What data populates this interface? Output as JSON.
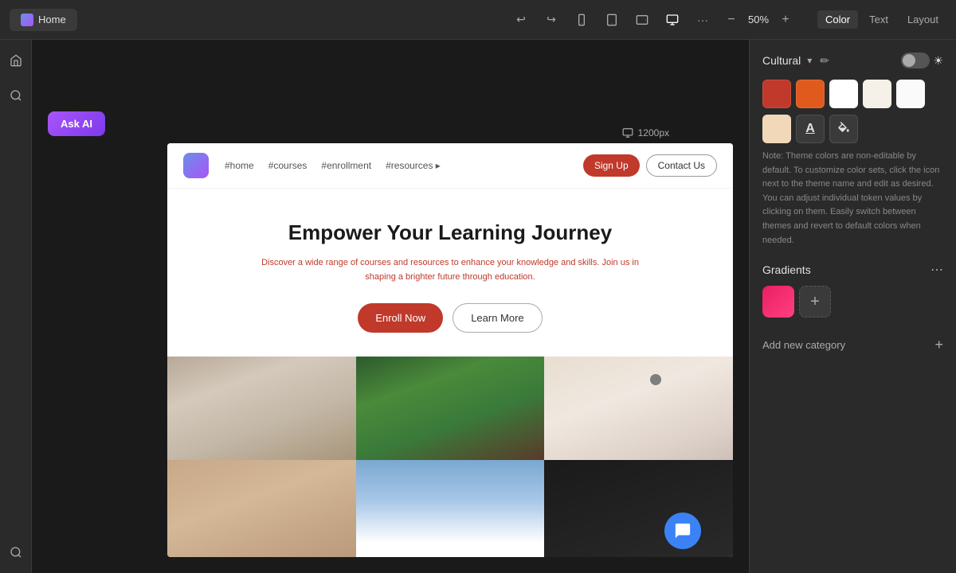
{
  "topbar": {
    "tab_label": "Home",
    "zoom": "50%",
    "zoom_minus": "−",
    "zoom_plus": "+"
  },
  "right_panel": {
    "tabs": [
      "Color",
      "Text",
      "Layout"
    ],
    "active_tab": "Color",
    "theme_name": "Cultural",
    "toggle_state": false,
    "color_swatches": [
      {
        "id": "s1",
        "class": "swatch-orange-dark",
        "label": "Dark Orange"
      },
      {
        "id": "s2",
        "class": "swatch-orange",
        "label": "Orange"
      },
      {
        "id": "s3",
        "class": "swatch-white",
        "label": "White"
      },
      {
        "id": "s4",
        "class": "swatch-cream",
        "label": "Cream"
      },
      {
        "id": "s5",
        "class": "swatch-offwhite",
        "label": "Off White"
      }
    ],
    "row2_swatches": [
      {
        "id": "r1",
        "class": "swatch-skin",
        "label": "Skin"
      }
    ],
    "note": "Note: Theme colors are non-editable by default. To customize color sets, click the icon next to the theme name and edit as desired. You can adjust individual token values by clicking on them. Easily switch between themes and revert to default colors when needed.",
    "gradients_title": "Gradients",
    "add_category_label": "Add new category"
  },
  "canvas": {
    "ask_ai_label": "Ask AI",
    "size_label": "1200px",
    "website": {
      "nav": {
        "links": [
          "#home",
          "#courses",
          "#enrollment",
          "#resources ▸"
        ],
        "btn_signup": "Sign Up",
        "btn_contact": "Contact Us"
      },
      "hero": {
        "title": "Empower Your Learning Journey",
        "subtitle": "Discover a wide range of courses and resources to enhance your knowledge and skills. Join us in shaping a brighter future through education.",
        "btn_enroll": "Enroll Now",
        "btn_learn": "Learn More"
      }
    }
  }
}
